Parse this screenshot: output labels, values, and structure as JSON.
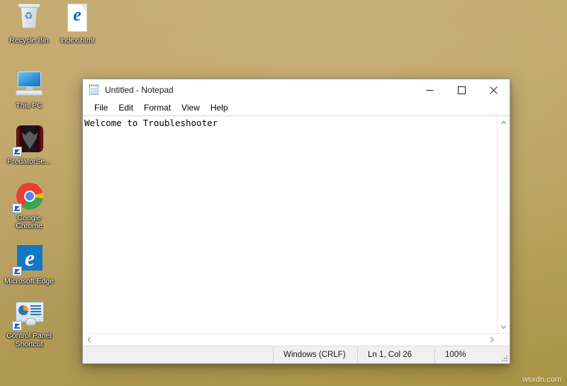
{
  "desktop": {
    "background_color": "#c0a568",
    "icons": [
      {
        "name": "recycle-bin",
        "label": "Recycle Bin",
        "icon": "recycle-bin-icon",
        "shortcut": false
      },
      {
        "name": "index-html",
        "label": "index.html",
        "icon": "html-file-icon",
        "shortcut": false
      },
      {
        "name": "this-pc",
        "label": "This PC",
        "icon": "this-pc-icon",
        "shortcut": false
      },
      {
        "name": "predator-sense",
        "label": "PredatorSe...",
        "icon": "predator-sense-icon",
        "shortcut": true
      },
      {
        "name": "google-chrome",
        "label": "Google Chrome",
        "icon": "google-chrome-icon",
        "shortcut": true
      },
      {
        "name": "microsoft-edge",
        "label": "Microsoft Edge",
        "icon": "microsoft-edge-icon",
        "shortcut": true
      },
      {
        "name": "control-panel",
        "label": "Control Panel Shortcut",
        "icon": "control-panel-icon",
        "shortcut": true
      }
    ]
  },
  "notepad": {
    "title": "Untitled - Notepad",
    "icon": "notepad-icon",
    "window_buttons": {
      "minimize": "minimize-icon",
      "maximize": "maximize-icon",
      "close": "close-icon"
    },
    "menu": [
      {
        "label": "File"
      },
      {
        "label": "Edit"
      },
      {
        "label": "Format"
      },
      {
        "label": "View"
      },
      {
        "label": "Help"
      }
    ],
    "document": {
      "text": "Welcome to Troubleshooter"
    },
    "scrollbars": {
      "up_arrow": "chevron-up-icon",
      "down_arrow": "chevron-down-icon",
      "left_arrow": "chevron-left-icon",
      "right_arrow": "chevron-right-icon"
    },
    "statusbar": {
      "line_ending": "Windows (CRLF)",
      "cursor_position": "Ln 1, Col 26",
      "zoom": "100%"
    }
  },
  "watermark": {
    "text": "wsxdn.com"
  }
}
